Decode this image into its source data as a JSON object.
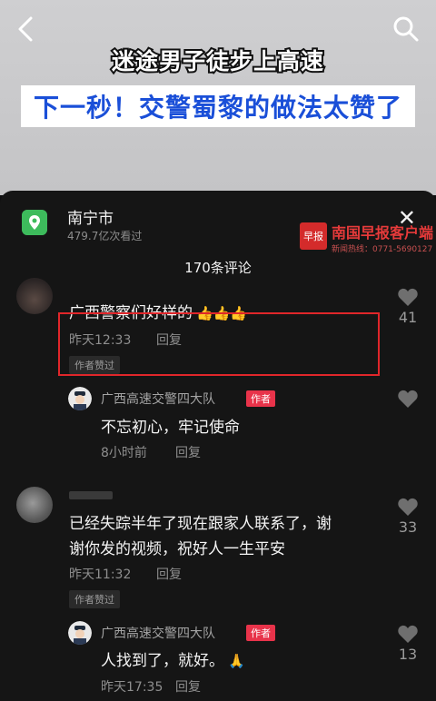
{
  "video": {
    "headline1": "迷途男子徒步上高速",
    "headline2": "下一秒！交警蜀黎的做法太赞了"
  },
  "panel": {
    "location_name": "南宁市",
    "location_views": "479.7亿次看过",
    "comment_count": "170条评论"
  },
  "comments": [
    {
      "text": "广西警察们好样的",
      "emoji": "👍👍👍",
      "time": "昨天12:33",
      "reply": "回复",
      "author_liked": "作者赞过",
      "likes": "41"
    },
    {
      "username": "广西高速交警四大队",
      "author_tag": "作者",
      "text": "不忘初心，牢记使命",
      "time": "8小时前",
      "reply": "回复"
    },
    {
      "text_line1": "已经失踪半年了现在跟家人联系了，谢",
      "text_line2": "谢你发的视频，祝好人一生平安",
      "time": "昨天11:32",
      "reply": "回复",
      "author_liked": "作者赞过",
      "likes": "33"
    },
    {
      "username": "广西高速交警四大队",
      "author_tag": "作者",
      "text": "人找到了，就好。",
      "emoji": "🙏",
      "time": "昨天17:35",
      "reply": "回复",
      "likes": "13"
    }
  ],
  "watermark": {
    "logo": "早报",
    "title": "南国早报客户端",
    "hotline": "新闻热线：0771-5690127"
  },
  "colors": {
    "panel_bg": "#151515",
    "highlight_border": "#e0262a",
    "author_tag": "#e8334a",
    "location_icon": "#3dbb5c",
    "headline2_text": "#1a4fd8"
  }
}
